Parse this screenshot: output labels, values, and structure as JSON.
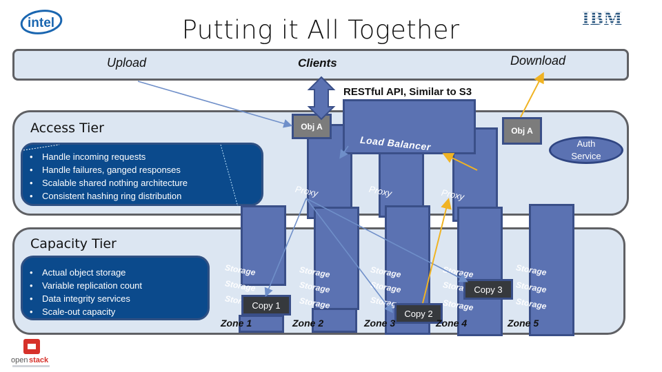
{
  "title": "Putting it All Together",
  "logos": {
    "left": "intel",
    "right": "IBM",
    "bottom": "openstack"
  },
  "clients_band": {
    "upload": "Upload",
    "clients": "Clients",
    "download": "Download"
  },
  "api_label": "RESTful API, Similar to S3",
  "access_tier": {
    "title": "Access Tier",
    "bullets": [
      "Handle incoming requests",
      "Handle failures, ganged responses",
      "Scalable shared nothing architecture",
      "Consistent hashing ring distribution"
    ],
    "obj_left": "Obj A",
    "obj_right": "Obj A",
    "load_balancer": "Load Balancer",
    "auth_service": [
      "Auth",
      "Service"
    ],
    "proxies": [
      "Proxy",
      "Proxy",
      "Proxy"
    ]
  },
  "capacity_tier": {
    "title": "Capacity Tier",
    "bullets": [
      "Actual object storage",
      "Variable replication count",
      "Data integrity services",
      "Scale-out capacity"
    ],
    "storage_label": "Storage",
    "zones": [
      "Zone 1",
      "Zone 2",
      "Zone 3",
      "Zone 4",
      "Zone 5"
    ],
    "copies": [
      "Copy 1",
      "Copy 2",
      "Copy 3"
    ]
  },
  "colors": {
    "panel": "#dce6f2",
    "node": "#5b72b2",
    "bullet_box": "#0b4a8c",
    "upload_arrow": "#6f8fc9",
    "download_arrow": "#f0b323"
  }
}
